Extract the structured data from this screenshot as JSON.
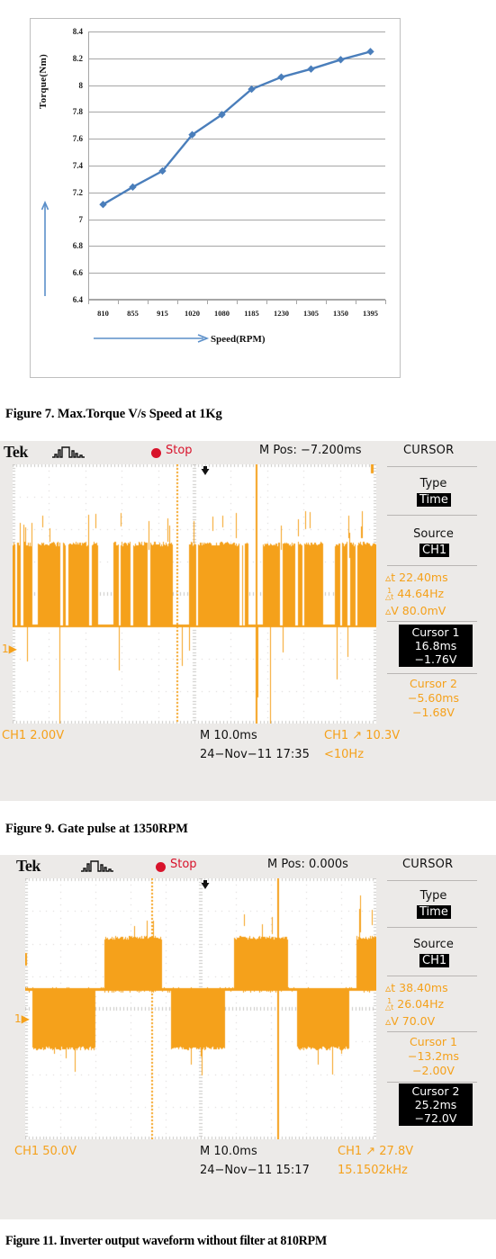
{
  "chart_data": {
    "type": "line",
    "title": "",
    "xlabel": "Speed(RPM)",
    "ylabel": "Torque(Nm)",
    "categories": [
      "810",
      "855",
      "915",
      "1020",
      "1080",
      "1185",
      "1230",
      "1305",
      "1350",
      "1395"
    ],
    "values": [
      7.11,
      7.24,
      7.36,
      7.63,
      7.78,
      7.97,
      8.06,
      8.12,
      8.19,
      8.25
    ],
    "y_ticks": [
      "8.4",
      "8.2",
      "8",
      "7.8",
      "7.6",
      "7.4",
      "7.2",
      "7",
      "6.8",
      "6.6",
      "6.4"
    ],
    "ylim": [
      6.4,
      8.4
    ],
    "grid": true,
    "legend": "none",
    "series_color": "#4a7ebb",
    "marker": "diamond"
  },
  "captions": {
    "figure_7": "Figure 7. Max.Torque V/s Speed at  1Kg",
    "figure_9": "Figure 9. Gate pulse at 1350RPM",
    "figure_11": "Figure 11. Inverter output waveform without filter at 810RPM"
  },
  "colors": {
    "trace": "#f5a11b",
    "stop_red": "#d8132b",
    "screen_bg": "#eceae8",
    "grid_bg": "#ffffff"
  },
  "scope_1": {
    "brand": "Tek",
    "run_state": "Stop",
    "m_pos": "M Pos: −7.200ms",
    "menu_title": "CURSOR",
    "side_panel": {
      "type_label": "Type",
      "type_value": "Time",
      "source_label": "Source",
      "source_value": "CH1",
      "delta_t": "▵t 22.40ms",
      "inv_delta_t": "44.64Hz",
      "delta_v": "▵V 80.0mV",
      "cursor1_label": "Cursor 1",
      "cursor1_time": "16.8ms",
      "cursor1_volt": "−1.76V",
      "cursor2_label": "Cursor 2",
      "cursor2_time": "−5.60ms",
      "cursor2_volt": "−1.68V"
    },
    "bottom": {
      "ch1_scale": "CH1  2.00V",
      "timebase": "M 10.0ms",
      "trigger": "CH1 ↗ 10.3V",
      "datetime": "24−Nov−11 17:35",
      "frequency": "<10Hz"
    },
    "channel_marker": "1"
  },
  "scope_2": {
    "brand": "Tek",
    "run_state": "Stop",
    "m_pos": "M Pos: 0.000s",
    "menu_title": "CURSOR",
    "side_panel": {
      "type_label": "Type",
      "type_value": "Time",
      "source_label": "Source",
      "source_value": "CH1",
      "delta_t": "▵t 38.40ms",
      "inv_delta_t": "26.04Hz",
      "delta_v": "▵V 70.0V",
      "cursor1_label": "Cursor 1",
      "cursor1_time": "−13.2ms",
      "cursor1_volt": "−2.00V",
      "cursor2_label": "Cursor 2",
      "cursor2_time": "25.2ms",
      "cursor2_volt": "−72.0V"
    },
    "bottom": {
      "ch1_scale": "CH1  50.0V",
      "timebase": "M 10.0ms",
      "trigger": "CH1 ↗ 27.8V",
      "datetime": "24−Nov−11 15:17",
      "frequency": "15.1502kHz"
    },
    "channel_marker": "1"
  }
}
